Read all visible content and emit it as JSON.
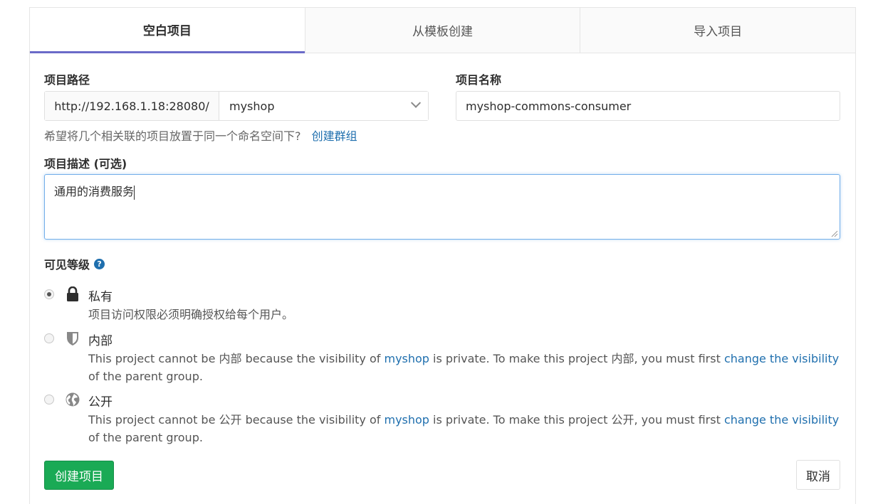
{
  "tabs": [
    {
      "label": "空白项目",
      "active": true
    },
    {
      "label": "从模板创建",
      "active": false
    },
    {
      "label": "导入项目",
      "active": false
    }
  ],
  "form": {
    "path_label": "项目路径",
    "path_prefix": "http://192.168.1.18:28080/",
    "namespace_value": "myshop",
    "name_label": "项目名称",
    "name_value": "myshop-commons-consumer",
    "help_text": "希望将几个相关联的项目放置于同一个命名空间下?",
    "help_link": "创建群组",
    "description_label": "项目描述 (可选)",
    "description_value": "通用的消费服务"
  },
  "visibility": {
    "label": "可见等级",
    "help_icon": "question-circle-icon",
    "options": [
      {
        "title": "私有",
        "icon": "lock-icon",
        "checked": true,
        "desc": "项目访问权限必须明确授权给每个用户。"
      },
      {
        "title": "内部",
        "icon": "shield-icon",
        "checked": false,
        "desc_pre": "This project cannot be 内部 because the visibility of ",
        "desc_link1": "myshop",
        "desc_mid": " is private. To make this project 内部, you must first ",
        "desc_link2": "change the visibility",
        "desc_post": " of the parent group."
      },
      {
        "title": "公开",
        "icon": "globe-icon",
        "checked": false,
        "desc_pre": "This project cannot be 公开 because the visibility of ",
        "desc_link1": "myshop",
        "desc_mid": " is private. To make this project 公开, you must first ",
        "desc_link2": "change the visibility",
        "desc_post": " of the parent group."
      }
    ]
  },
  "actions": {
    "create_label": "创建项目",
    "cancel_label": "取消"
  },
  "colors": {
    "accent_tab": "#6b6bc8",
    "link": "#1f6fae",
    "create_button": "#1aaa55",
    "focus_border": "#73afea"
  }
}
